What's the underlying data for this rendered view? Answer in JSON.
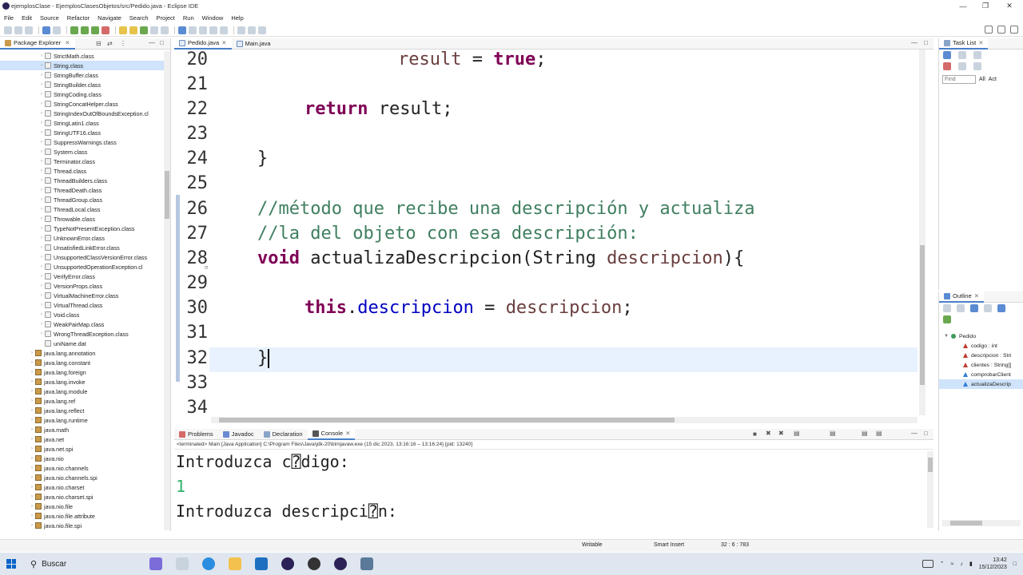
{
  "window": {
    "title": "ejemplosClase - EjemplosClasesObjetos/src/Pedido.java - Eclipse IDE"
  },
  "menu": [
    "File",
    "Edit",
    "Source",
    "Refactor",
    "Navigate",
    "Search",
    "Project",
    "Run",
    "Window",
    "Help"
  ],
  "package_explorer": {
    "title": "Package Explorer",
    "classes": [
      "StrictMath.class",
      "String.class",
      "StringBuffer.class",
      "StringBuilder.class",
      "StringCoding.class",
      "StringConcatHelper.class",
      "StringIndexOutOfBoundsException.cl",
      "StringLatin1.class",
      "StringUTF16.class",
      "SuppressWarnings.class",
      "System.class",
      "Terminator.class",
      "Thread.class",
      "ThreadBuilders.class",
      "ThreadDeath.class",
      "ThreadGroup.class",
      "ThreadLocal.class",
      "Throwable.class",
      "TypeNotPresentException.class",
      "UnknownError.class",
      "UnsatisfiedLinkError.class",
      "UnsupportedClassVersionError.class",
      "UnsupportedOperationException.cl",
      "VerifyError.class",
      "VersionProps.class",
      "VirtualMachineError.class",
      "VirtualThread.class",
      "Void.class",
      "WeakPairMap.class",
      "WrongThreadException.class",
      "uniName.dat"
    ],
    "packages": [
      "java.lang.annotation",
      "java.lang.constant",
      "java.lang.foreign",
      "java.lang.invoke",
      "java.lang.module",
      "java.lang.ref",
      "java.lang.reflect",
      "java.lang.runtime",
      "java.math",
      "java.net",
      "java.net.spi",
      "java.nio",
      "java.nio.channels",
      "java.nio.channels.spi",
      "java.nio.charset",
      "java.nio.charset.spi",
      "java.nio.file",
      "java.nio.file.attribute",
      "java.nio.file.spi"
    ]
  },
  "editor": {
    "tabs": [
      "Pedido.java",
      "Main.java"
    ],
    "line_numbers": [
      "20",
      "21",
      "22",
      "23",
      "24",
      "25",
      "26",
      "27",
      "28",
      "29",
      "30",
      "31",
      "32",
      "33",
      "34"
    ],
    "code": {
      "l20_var": "result",
      "l20_eq": " = ",
      "l20_kw": "true",
      "l20_end": ";",
      "l22_kw": "return",
      "l22_rest": " result;",
      "l24": "}",
      "l26": "//método que recibe una descripción y actualiza",
      "l27": "//la del objeto con esa descripción:",
      "l28_kw": "void",
      "l28_a": " actualizaDescripcion(String ",
      "l28_var": "descripcion",
      "l28_b": "){",
      "l30_kw": "this",
      "l30_dot": ".",
      "l30_fld": "descripcion",
      "l30_eq": " = ",
      "l30_var": "descripcion",
      "l30_end": ";",
      "l32": "}"
    }
  },
  "console": {
    "tabs": [
      "Problems",
      "Javadoc",
      "Declaration",
      "Console"
    ],
    "info": "<terminated> Main [Java Application] C:\\Program Files\\Java\\jdk-20\\bin\\javaw.exe (15 dic 2023, 13:16:16 – 13:16:24) [pid: 13240]",
    "lines": [
      "Introduzca c⍰digo:",
      "1",
      "Introduzca descripci⍰n:"
    ]
  },
  "task_list": {
    "title": "Task List",
    "find_placeholder": "Find",
    "all": "All",
    "activate": "Act"
  },
  "outline": {
    "title": "Outline",
    "root": "Pedido",
    "members": [
      "codigo : int",
      "descripcion : Stri",
      "clientes : String[]",
      "comprobarClient",
      "actualizaDescrip"
    ]
  },
  "status": {
    "writable": "Writable",
    "insert": "Smart Insert",
    "position": "32 : 6 : 783"
  },
  "taskbar": {
    "search": "Buscar",
    "time": "13:42",
    "date": "15/12/2023"
  },
  "colors": {
    "keyword": "#7f0055",
    "comment": "#3f7f5f",
    "field": "#0000c0",
    "local": "#6a3e3e",
    "console_input": "#2fb36b"
  }
}
